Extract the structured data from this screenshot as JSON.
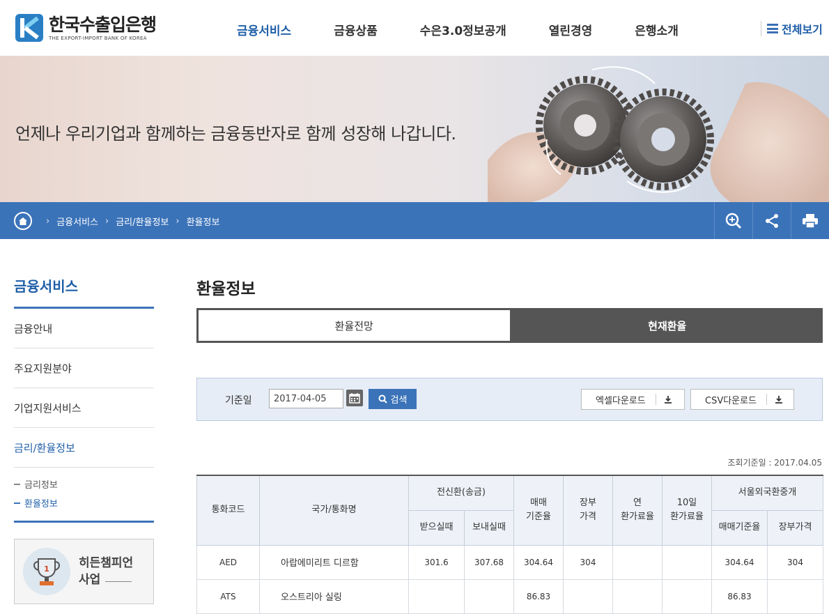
{
  "header": {
    "logo_ko": "한국수출입은행",
    "logo_en": "THE EXPORT-IMPORT BANK OF KOREA",
    "nav": [
      "금융서비스",
      "금융상품",
      "수은3.0정보공개",
      "열린경영",
      "은행소개"
    ],
    "active_nav": "금융서비스",
    "allview_label": "전체보기"
  },
  "banner": {
    "text": "언제나 우리기업과 함께하는 금융동반자로 함께 성장해 나갑니다."
  },
  "breadcrumb": [
    "금융서비스",
    "금리/환율정보",
    "환율정보"
  ],
  "lnb": {
    "title": "금융서비스",
    "items": [
      "금융안내",
      "주요지원분야",
      "기업지원서비스",
      "금리/환율정보"
    ],
    "sub_items": [
      "금리정보",
      "환율정보"
    ],
    "promo_line1": "히든챔피언",
    "promo_line2": "사업",
    "promo_badge": "1"
  },
  "content": {
    "title": "환율정보",
    "tabs": [
      "환율전망",
      "현재환율"
    ],
    "search": {
      "label": "기준일",
      "date": "2017-04-05",
      "search_label": "검색",
      "excel_label": "엑셀다운로드",
      "csv_label": "CSV다운로드"
    },
    "asof": "조회기준일 : 2017.04.05",
    "table": {
      "h_code": "통화코드",
      "h_name": "국가/통화명",
      "h_tt": "전신환(송금)",
      "h_tt_buy": "받으실때",
      "h_tt_sell": "보내실때",
      "h_base": [
        "매매",
        "기준율"
      ],
      "h_book": [
        "장부",
        "가격"
      ],
      "h_year": [
        "연",
        "환가료율"
      ],
      "h_10d": [
        "10일",
        "환가료율"
      ],
      "h_seoul": "서울외국환중개",
      "h_seoul_base": "매매기준율",
      "h_seoul_book": "장부가격",
      "rows": [
        {
          "code": "AED",
          "name": "아랍에미리트 디르함",
          "tt_buy": "301.6",
          "tt_sell": "307.68",
          "base": "304.64",
          "book": "304",
          "year": "",
          "d10": "",
          "s_base": "304.64",
          "s_book": "304"
        },
        {
          "code": "ATS",
          "name": "오스트리아 실링",
          "tt_buy": "",
          "tt_sell": "",
          "base": "86.83",
          "book": "",
          "year": "",
          "d10": "",
          "s_base": "86.83",
          "s_book": ""
        }
      ]
    }
  },
  "colors": {
    "primary": "#3b73b9",
    "nav_active": "#1f5fa8",
    "tab_dark": "#555555"
  }
}
